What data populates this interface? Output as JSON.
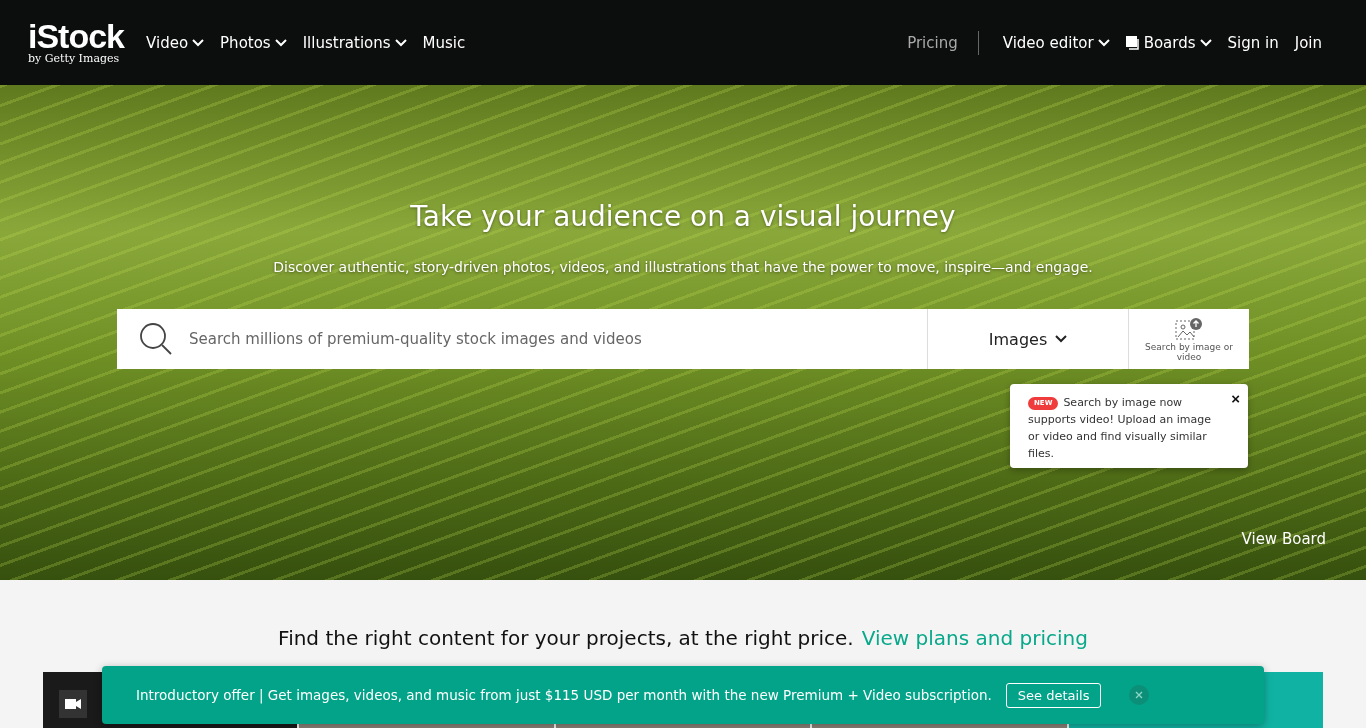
{
  "header": {
    "logo": {
      "wordmark": "iStock",
      "tagline": "by Getty Images"
    },
    "nav_left": [
      {
        "label": "Video",
        "dropdown": true
      },
      {
        "label": "Photos",
        "dropdown": true
      },
      {
        "label": "Illustrations",
        "dropdown": true
      },
      {
        "label": "Music",
        "dropdown": false
      }
    ],
    "pricing": "Pricing",
    "nav_right": [
      {
        "label": "Video editor",
        "kind": "menu"
      },
      {
        "label": "Boards",
        "kind": "boards"
      },
      {
        "label": "Sign in",
        "kind": "link"
      },
      {
        "label": "Join",
        "kind": "link"
      }
    ]
  },
  "hero": {
    "title": "Take your audience on a visual journey",
    "subtitle": "Discover authentic, story-driven photos, videos, and illustrations that have the power to move, inspire—and engage.",
    "search": {
      "placeholder": "Search millions of premium-quality stock images and videos",
      "type": "Images",
      "visual_search": "Search by image or video"
    },
    "tooltip": {
      "badge": "NEW",
      "text": "Search by image now supports video! Upload an image or video and find visually similar files.",
      "close": "×"
    },
    "view_board": "View Board"
  },
  "promo": {
    "text": "Find the right content for your projects, at the right price.",
    "link": "View plans and pricing"
  },
  "tiles": [
    {
      "kind": "video"
    },
    {
      "kind": "photo"
    },
    {
      "kind": "photo"
    },
    {
      "kind": "photo"
    },
    {
      "kind": "teal"
    }
  ],
  "banner": {
    "text": "Introductory offer | Get images, videos, and music from just $115 USD per month with the new Premium + Video subscription.",
    "button": "See details"
  }
}
